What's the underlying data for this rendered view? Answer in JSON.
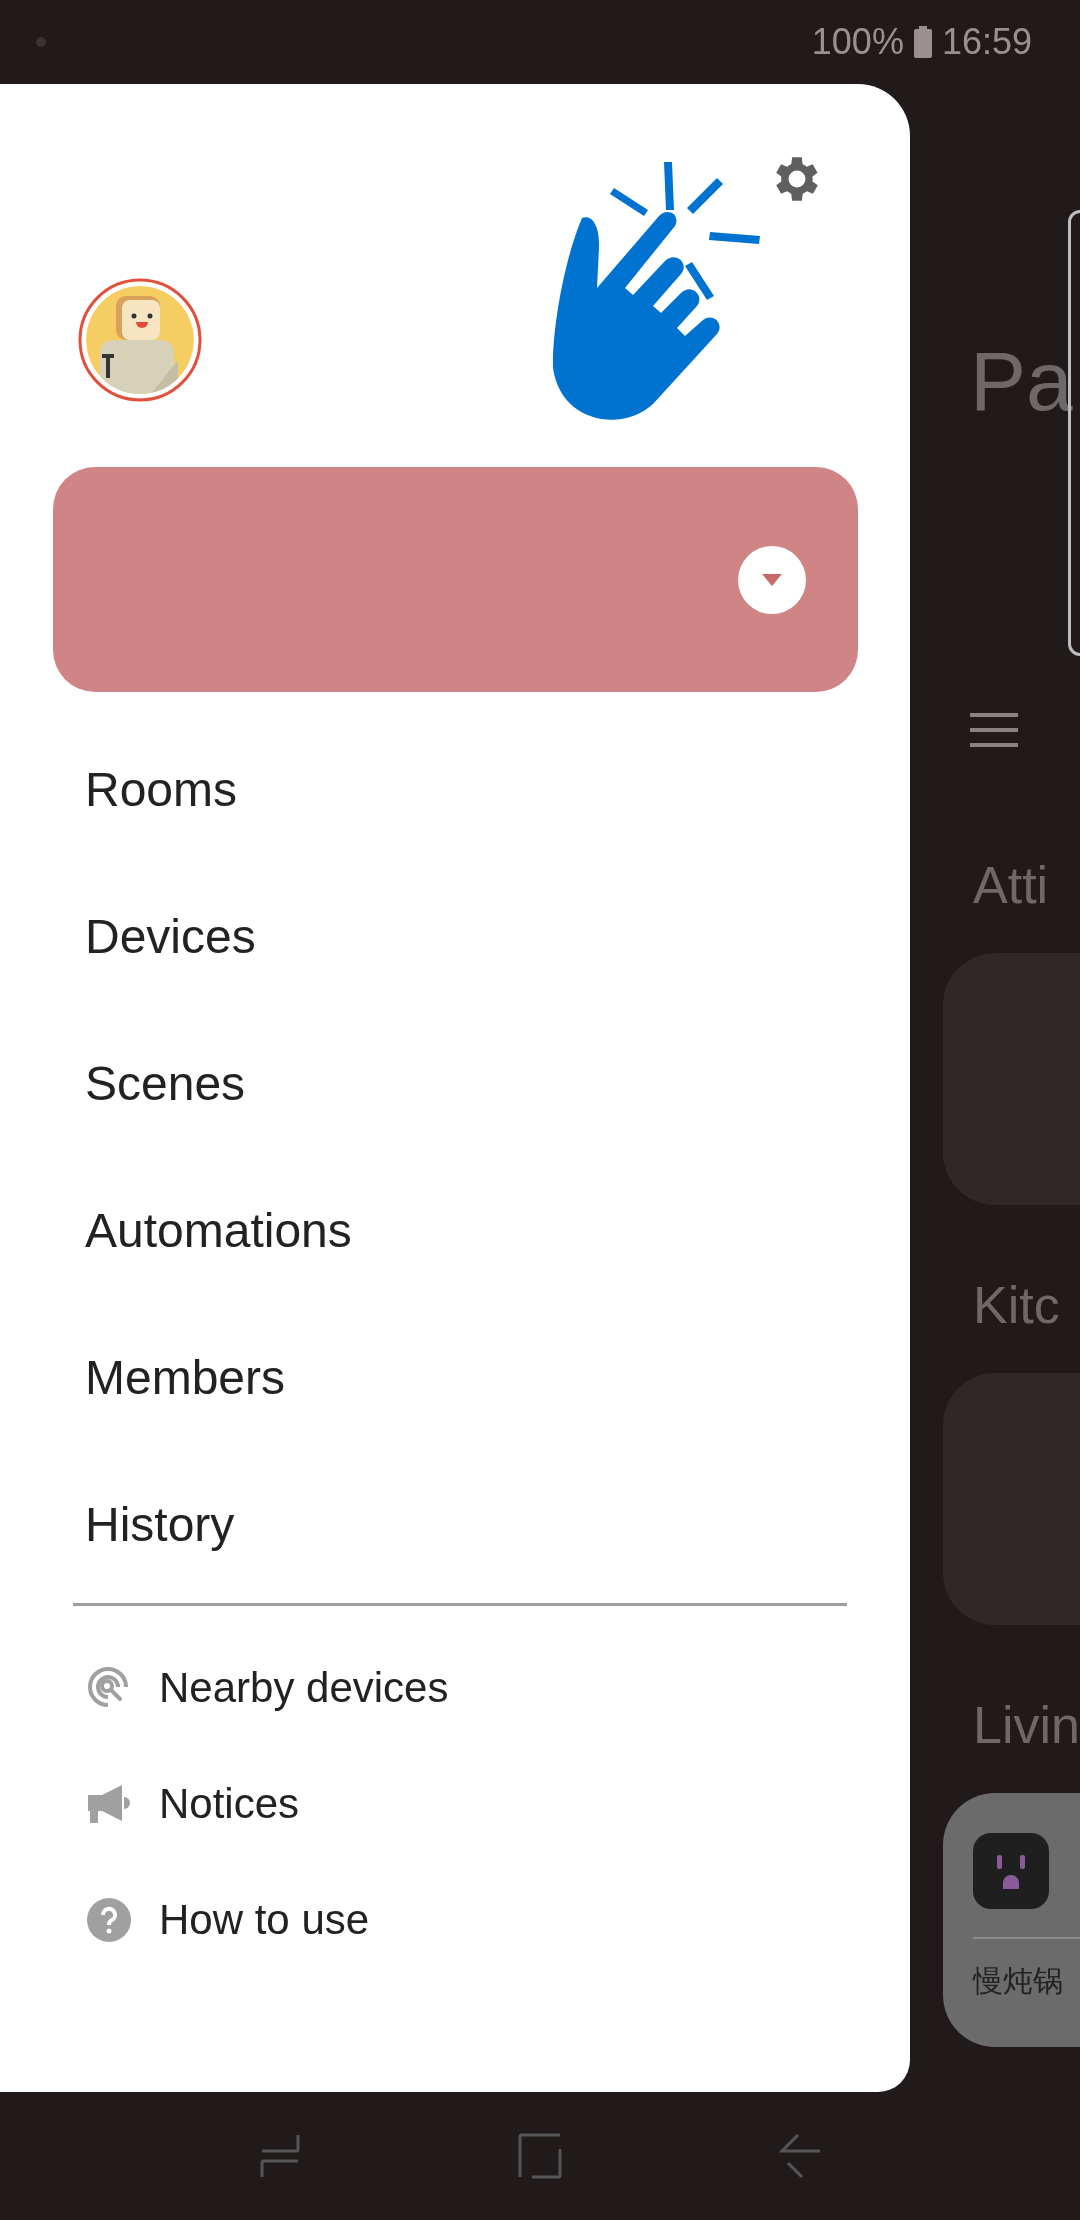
{
  "status_bar": {
    "battery": "100%",
    "time": "16:59"
  },
  "drawer": {
    "menu": [
      {
        "label": "Rooms"
      },
      {
        "label": "Devices"
      },
      {
        "label": "Scenes"
      },
      {
        "label": "Automations"
      },
      {
        "label": "Members"
      },
      {
        "label": "History"
      }
    ],
    "secondary_menu": [
      {
        "kind": "nearby",
        "label": "Nearby devices"
      },
      {
        "kind": "notices",
        "label": "Notices"
      },
      {
        "kind": "help",
        "label": "How to use"
      }
    ]
  },
  "background": {
    "title": "Pa",
    "sections": [
      {
        "kind": "empty",
        "title": "Atti"
      },
      {
        "kind": "empty",
        "title": "Kitc"
      },
      {
        "kind": "device",
        "title": "Livin",
        "device": "慢炖锅"
      }
    ]
  }
}
